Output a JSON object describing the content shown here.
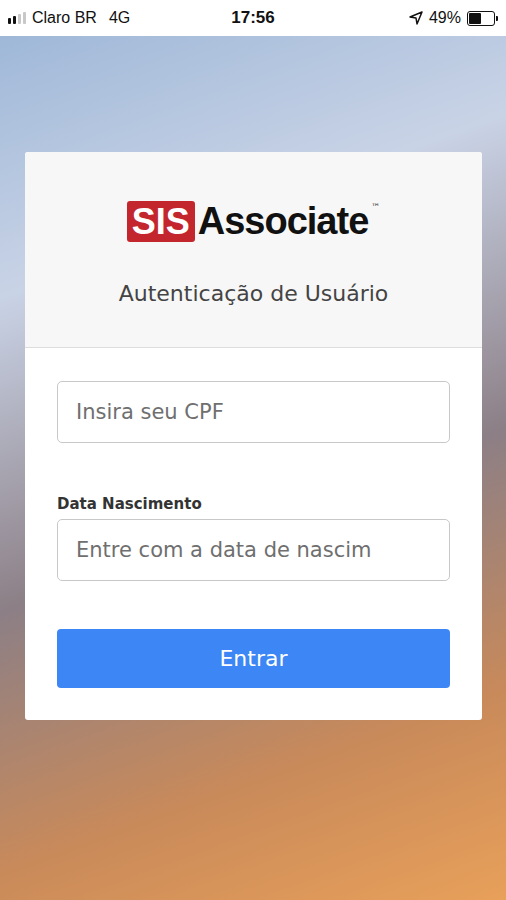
{
  "status_bar": {
    "carrier": "Claro BR",
    "network": "4G",
    "time": "17:56",
    "battery": "49%",
    "battery_level": 0.49,
    "signal_level": 0.5
  },
  "logo": {
    "badge": "SIS",
    "name": "Associate",
    "mark": "™"
  },
  "title": "Autenticação de Usuário",
  "fields": [
    {
      "label": "",
      "placeholder": "Insira seu CPF"
    },
    {
      "label": "Data Nascimento",
      "placeholder": "Entre com a data de nascim"
    }
  ],
  "button": "Entrar"
}
